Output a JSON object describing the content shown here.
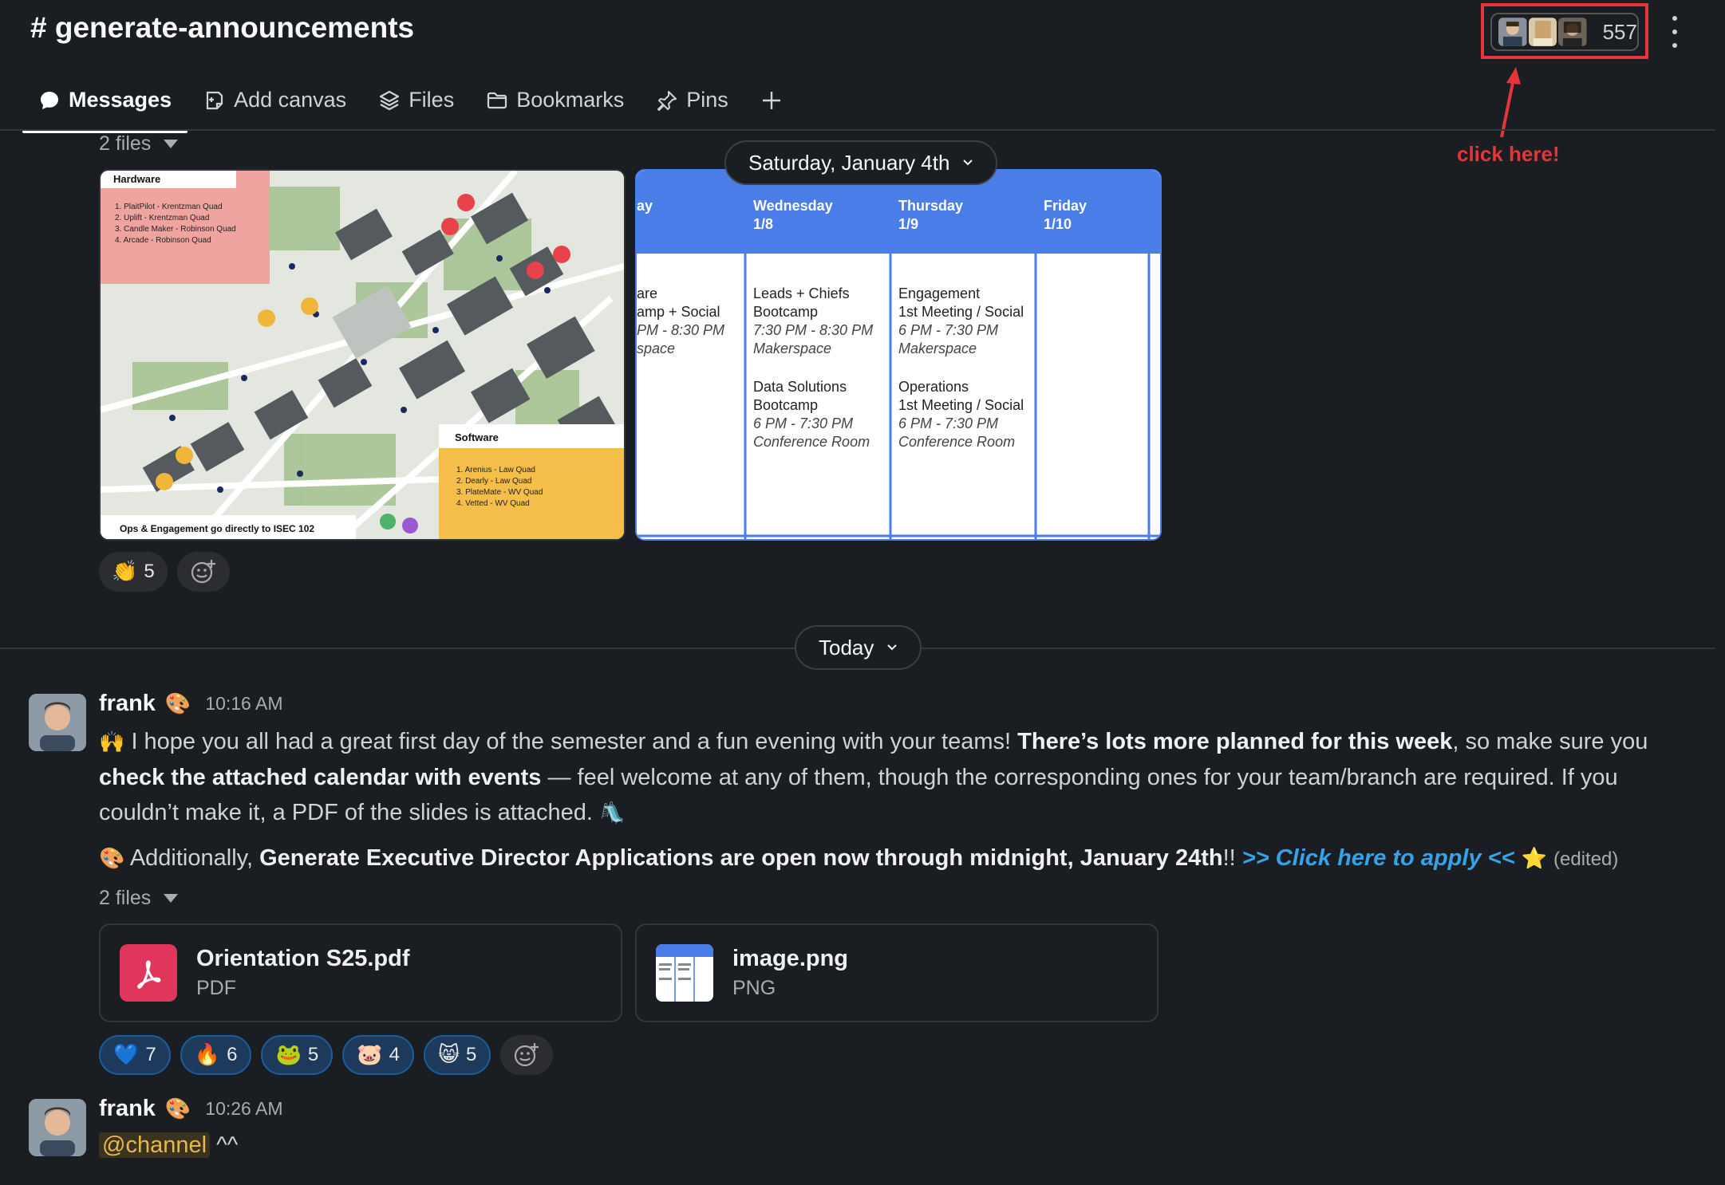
{
  "channel": {
    "title": "# generate-announcements",
    "member_count": "557"
  },
  "tabs": [
    {
      "label": "Messages",
      "icon": "chat-bubble-icon"
    },
    {
      "label": "Add canvas",
      "icon": "canvas-icon"
    },
    {
      "label": "Files",
      "icon": "layers-icon"
    },
    {
      "label": "Bookmarks",
      "icon": "folder-icon"
    },
    {
      "label": "Pins",
      "icon": "pin-icon"
    }
  ],
  "annotation": {
    "text": "click here!",
    "color": "#e5343a"
  },
  "top_attachments": {
    "files_label": "2 files",
    "map_image": {
      "hardware_title": "Hardware",
      "hardware_items": [
        "1. PlaitPilot - Krentzman Quad",
        "2. Uplift - Krentzman Quad",
        "3. Candle Maker - Robinson Quad",
        "4. Arcade - Robinson Quad"
      ],
      "software_title": "Software",
      "software_items": [
        "1. Arenius - Law Quad",
        "2. Dearly - Law Quad",
        "3. PlateMate - WV Quad",
        "4. Vetted - WV Quad"
      ],
      "footer": "Ops & Engagement go directly to ISEC 102"
    },
    "calendar_image": {
      "columns": [
        {
          "day": "ay",
          "date": "",
          "events": [
            {
              "title": "are",
              "title2": "amp + Social",
              "time": "PM - 8:30 PM",
              "place": "space"
            }
          ]
        },
        {
          "day": "Wednesday",
          "date": "1/8",
          "events": [
            {
              "title": "Leads + Chiefs",
              "title2": "Bootcamp",
              "time": "7:30 PM - 8:30 PM",
              "place": "Makerspace"
            },
            {
              "title": "Data Solutions",
              "title2": "Bootcamp",
              "time": "6 PM - 7:30 PM",
              "place": "Conference Room"
            }
          ]
        },
        {
          "day": "Thursday",
          "date": "1/9",
          "events": [
            {
              "title": "Engagement",
              "title2": "1st Meeting / Social",
              "time": "6 PM - 7:30 PM",
              "place": "Makerspace"
            },
            {
              "title": "Operations",
              "title2": "1st Meeting / Social",
              "time": "6 PM - 7:30 PM",
              "place": "Conference Room"
            }
          ]
        },
        {
          "day": "Friday",
          "date": "1/10",
          "events": []
        }
      ]
    },
    "reactions": [
      {
        "emoji": "👏",
        "count": "5"
      }
    ]
  },
  "date_pills": {
    "saturday": "Saturday, January 4th",
    "today": "Today"
  },
  "messages": [
    {
      "author": "frank",
      "time": "10:16 AM",
      "para1_parts": [
        "I hope you all had a great first day of the semester and a fun evening with your teams! ",
        "There’s lots more planned for this week",
        ", so make sure you ",
        "check the attached calendar with events",
        " — feel welcome at any of them, though the corresponding ones for your team/branch are required. If you couldn’t make it, a PDF of the slides is attached. "
      ],
      "para2_parts": [
        " Additionally, ",
        "Generate Executive Director Applications are open now through midnight, January 24th",
        "!! ",
        ">> Click here to apply <<",
        "(edited)"
      ],
      "files_label": "2 files",
      "files": [
        {
          "name": "Orientation S25.pdf",
          "type": "PDF"
        },
        {
          "name": "image.png",
          "type": "PNG"
        }
      ],
      "reactions": [
        {
          "emoji": "💙",
          "count": "7"
        },
        {
          "emoji": "🔥",
          "count": "6"
        },
        {
          "emoji": "🐸",
          "count": "5"
        },
        {
          "emoji": "🐷",
          "count": "4"
        },
        {
          "emoji": "😸",
          "count": "5"
        }
      ]
    },
    {
      "author": "frank",
      "time": "10:26 AM",
      "mention": "@channel",
      "text": " ^^"
    }
  ]
}
